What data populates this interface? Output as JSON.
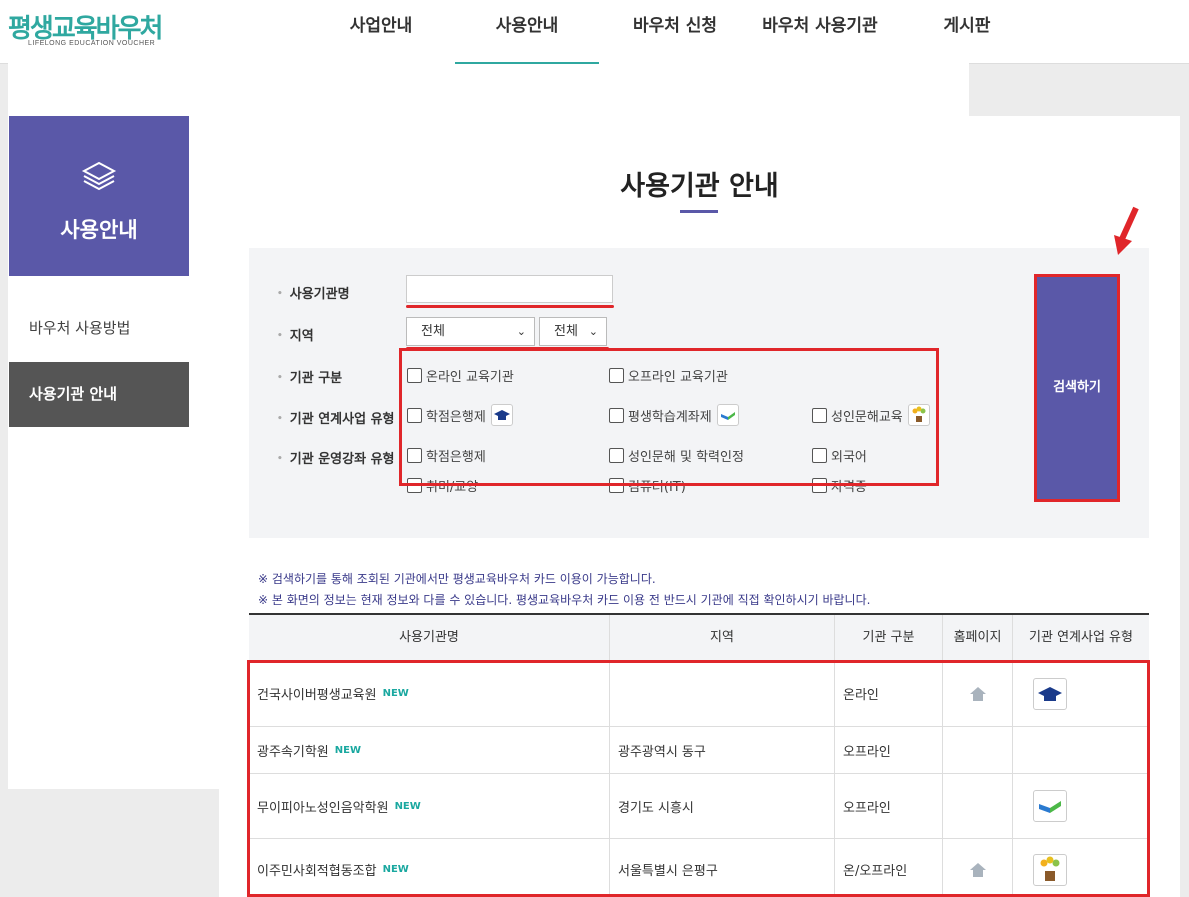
{
  "header": {
    "logo_main": "평생교육바우처",
    "logo_sub": "LIFELONG EDUCATION VOUCHER",
    "nav": [
      {
        "label": "사업안내"
      },
      {
        "label": "사용안내"
      },
      {
        "label": "바우처 신청"
      },
      {
        "label": "바우처 사용기관"
      },
      {
        "label": "게시판"
      }
    ],
    "active_nav": "사용안내"
  },
  "sidebar": {
    "icon": "layers-icon",
    "title": "사용안내",
    "links": [
      {
        "label": "바우처 사용방법",
        "active": false
      },
      {
        "label": "사용기관 안내",
        "active": true
      }
    ]
  },
  "main": {
    "page_title": "사용기관 안내",
    "search": {
      "name_label": "사용기관명",
      "name_value": "",
      "region_label": "지역",
      "region1_value": "전체",
      "region2_value": "전체",
      "type_label": "기관 구분",
      "type_options": [
        "온라인 교육기관",
        "오프라인 교육기관"
      ],
      "program_label": "기관 연계사업 유형",
      "program_options": [
        "학점은행제",
        "평생학습계좌제",
        "성인문해교육"
      ],
      "course_label": "기관 운영강좌 유형",
      "course_options": [
        "학점은행제",
        "성인문해 및 학력인정",
        "외국어",
        "취미/교양",
        "컴퓨터(IT)",
        "자격증"
      ],
      "search_button": "검색하기"
    },
    "notices": [
      "※ 검색하기를 통해 조회된 기관에서만 평생교육바우처 카드 이용이 가능합니다.",
      "※ 본 화면의 정보는 현재 정보와 다를 수 있습니다. 평생교육바우처 카드 이용 전 반드시 기관에 직접 확인하시기 바랍니다."
    ],
    "table": {
      "headers": [
        "사용기관명",
        "지역",
        "기관 구분",
        "홈페이지",
        "기관 연계사업 유형"
      ],
      "new_badge": "NEW",
      "rows": [
        {
          "name": "건국사이버평생교육원",
          "region": "",
          "type": "온라인",
          "homepage": true,
          "program_icon": "graduation-cap-icon"
        },
        {
          "name": "광주속기학원",
          "region": "광주광역시 동구",
          "type": "오프라인",
          "homepage": false,
          "program_icon": ""
        },
        {
          "name": "무이피아노성인음악학원",
          "region": "경기도 시흥시",
          "type": "오프라인",
          "homepage": false,
          "program_icon": "book-icon"
        },
        {
          "name": "이주민사회적협동조합",
          "region": "서울특별시 은평구",
          "type": "온/오프라인",
          "homepage": true,
          "program_icon": "flower-pot-icon"
        }
      ]
    }
  },
  "colors": {
    "brand_purple": "#5a58a8",
    "brand_teal": "#2fa8a0",
    "highlight_red": "#e0262a"
  }
}
